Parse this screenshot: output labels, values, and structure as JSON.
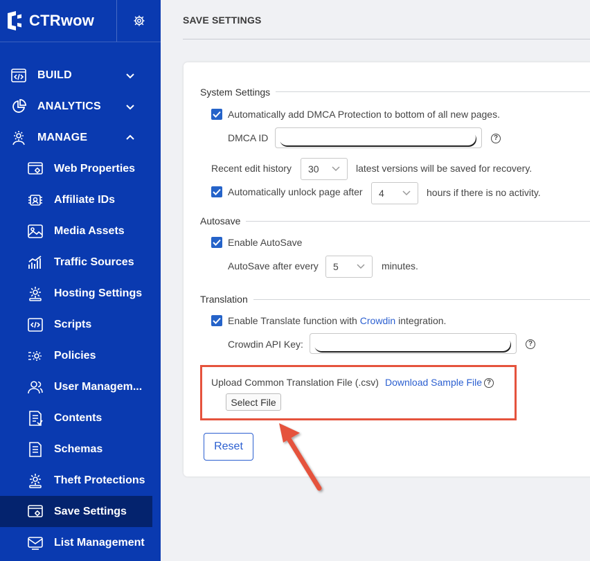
{
  "brand": {
    "name": "CTRwow",
    "settings_icon": "gear-icon"
  },
  "sidebar": {
    "sections": [
      {
        "label": "BUILD",
        "icon": "code-window-icon",
        "expanded": false
      },
      {
        "label": "ANALYTICS",
        "icon": "pie-chart-icon",
        "expanded": false
      },
      {
        "label": "MANAGE",
        "icon": "cog-user-icon",
        "expanded": true
      }
    ],
    "items": [
      {
        "label": "Web Properties",
        "icon": "web-gear-icon",
        "active": false
      },
      {
        "label": "Affiliate IDs",
        "icon": "affiliate-icon",
        "active": false
      },
      {
        "label": "Media Assets",
        "icon": "image-icon",
        "active": false
      },
      {
        "label": "Traffic Sources",
        "icon": "bar-chart-icon",
        "active": false
      },
      {
        "label": "Hosting Settings",
        "icon": "hosting-gear-icon",
        "active": false
      },
      {
        "label": "Scripts",
        "icon": "code-icon",
        "active": false
      },
      {
        "label": "Policies",
        "icon": "policy-icon",
        "active": false
      },
      {
        "label": "User Managem...",
        "icon": "users-icon",
        "active": false
      },
      {
        "label": "Contents",
        "icon": "document-icon",
        "active": false
      },
      {
        "label": "Schemas",
        "icon": "schema-icon",
        "active": false
      },
      {
        "label": "Theft Protections",
        "icon": "shield-gear-icon",
        "active": false
      },
      {
        "label": "Save Settings",
        "icon": "save-settings-icon",
        "active": true
      },
      {
        "label": "List Management",
        "icon": "mail-icon",
        "active": false
      }
    ]
  },
  "page": {
    "title": "SAVE SETTINGS"
  },
  "system_settings": {
    "title": "System Settings",
    "dmca_checkbox_label": "Automatically add DMCA Protection to bottom of all new pages.",
    "dmca_checked": true,
    "dmca_id_label": "DMCA ID",
    "dmca_id_value": "",
    "help_glyph": "?",
    "recent_history_label": "Recent edit history",
    "recent_history_value": "30",
    "recent_history_suffix": "latest versions will be saved for recovery.",
    "unlock_checkbox_label": "Automatically unlock page after",
    "unlock_checked": true,
    "unlock_value": "4",
    "unlock_suffix": "hours if there is no activity."
  },
  "autosave": {
    "title": "Autosave",
    "enable_label": "Enable AutoSave",
    "enabled": true,
    "every_label": "AutoSave after every",
    "every_value": "5",
    "every_suffix": "minutes."
  },
  "translation": {
    "title": "Translation",
    "enable_label_prefix": "Enable Translate function with",
    "enable_link": "Crowdin",
    "enable_label_suffix": "integration.",
    "enabled": true,
    "api_key_label": "Crowdin API Key:",
    "api_key_value": "",
    "upload_label": "Upload Common Translation File (.csv)",
    "download_link": "Download Sample File",
    "select_file_label": "Select File"
  },
  "actions": {
    "reset_label": "Reset"
  },
  "colors": {
    "sidebar_bg": "#0a3ab0",
    "sidebar_active": "#04236e",
    "accent": "#2563c9",
    "link": "#2b5fd0",
    "highlight": "#e5533d"
  }
}
